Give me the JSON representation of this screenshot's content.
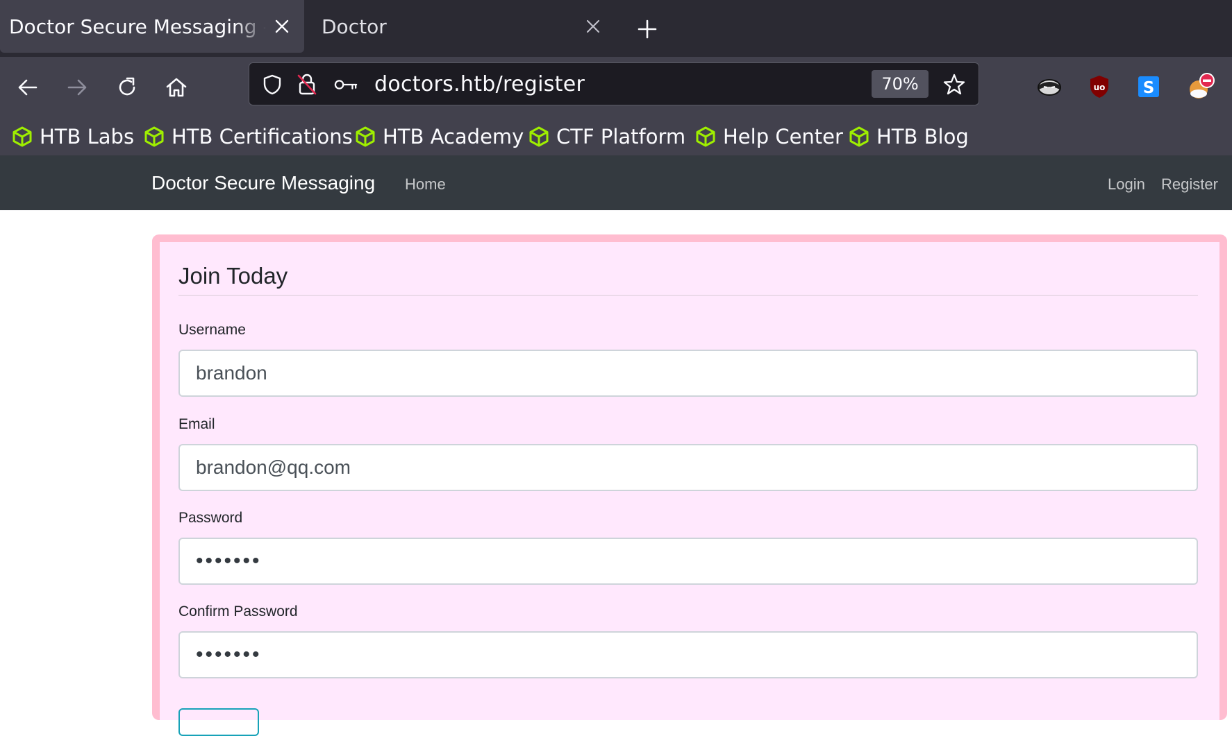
{
  "browser": {
    "tabs": [
      {
        "title": "Doctor Secure Messaging - R",
        "active": true
      },
      {
        "title": "Doctor",
        "active": false
      }
    ],
    "address_bar": {
      "url": "doctors.htb/register",
      "zoom": "70%"
    },
    "bookmarks": [
      "HTB Labs",
      "HTB Certifications",
      "HTB Academy",
      "CTF Platform",
      "Help Center",
      "HTB Blog"
    ],
    "extension_icons": [
      "ninja-extension-icon",
      "ublock-origin-icon",
      "s-extension-icon",
      "blocker-extension-icon"
    ]
  },
  "site": {
    "brand": "Doctor Secure Messaging",
    "nav_home": "Home",
    "nav_login": "Login",
    "nav_register": "Register"
  },
  "form": {
    "legend": "Join Today",
    "username": {
      "label": "Username",
      "value": "brandon"
    },
    "email": {
      "label": "Email",
      "value": "brandon@qq.com"
    },
    "password": {
      "label": "Password",
      "value": "•••••••"
    },
    "confirm_password": {
      "label": "Confirm Password",
      "value": "•••••••"
    }
  },
  "colors": {
    "card_background": "#ffe8fd",
    "card_border": "#ffbdd0",
    "site_navbar": "#343a40",
    "bookmark_icon": "#9fef00"
  }
}
